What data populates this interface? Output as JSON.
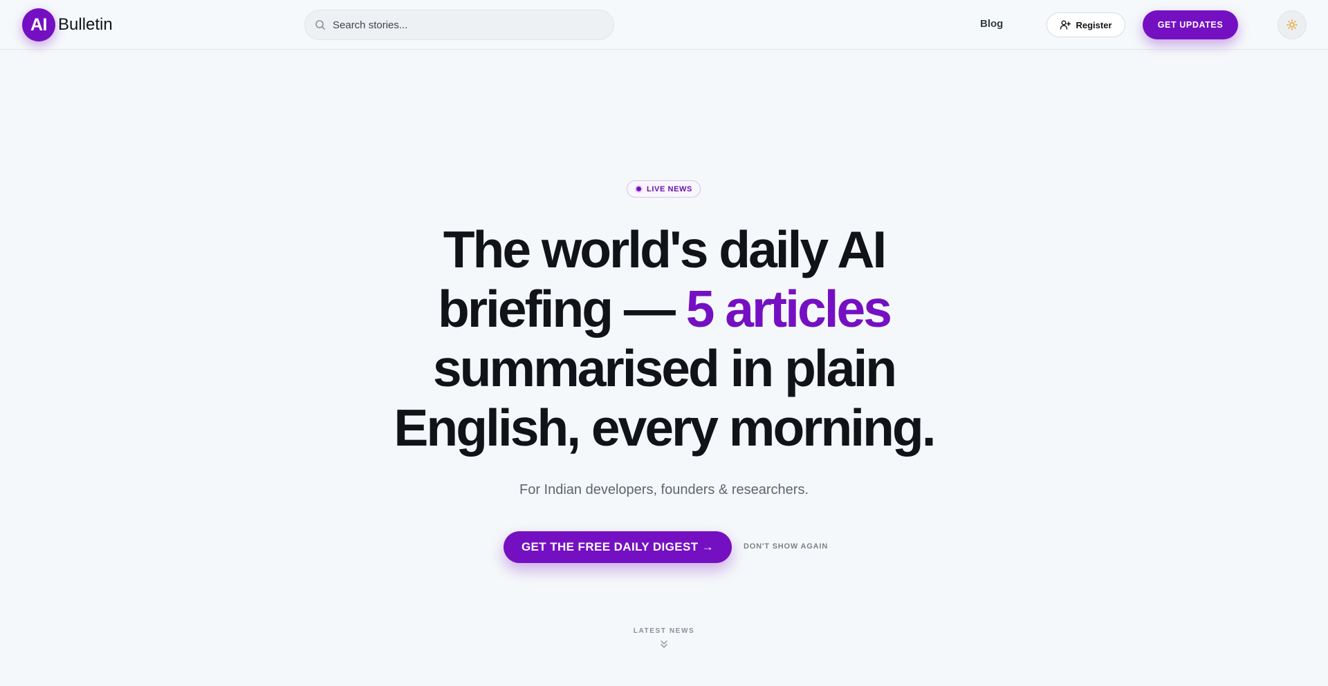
{
  "header": {
    "logo_badge": "AI",
    "logo_text": "Bulletin",
    "search_placeholder": "Search stories...",
    "nav_blog": "Blog",
    "register_label": "Register",
    "updates_label": "GET UPDATES",
    "theme_icon": "sun-icon"
  },
  "hero": {
    "badge": "LIVE NEWS",
    "headline": {
      "line1": "The world's daily AI",
      "line2_pre": "briefing —",
      "line2_accent": "5 articles",
      "line3": "summarised in plain",
      "line4": "English, every morning."
    },
    "subtitle": "For Indian developers, founders & researchers.",
    "cta_label": "GET THE FREE DAILY DIGEST →",
    "dismiss_label": "DON'T SHOW AGAIN"
  },
  "latest": {
    "label": "LATEST NEWS",
    "icon": "chevrons-down-icon"
  },
  "colors": {
    "accent": "#7510c2",
    "background": "#f5f8fa",
    "text": "#111318",
    "muted": "#5f656c"
  }
}
